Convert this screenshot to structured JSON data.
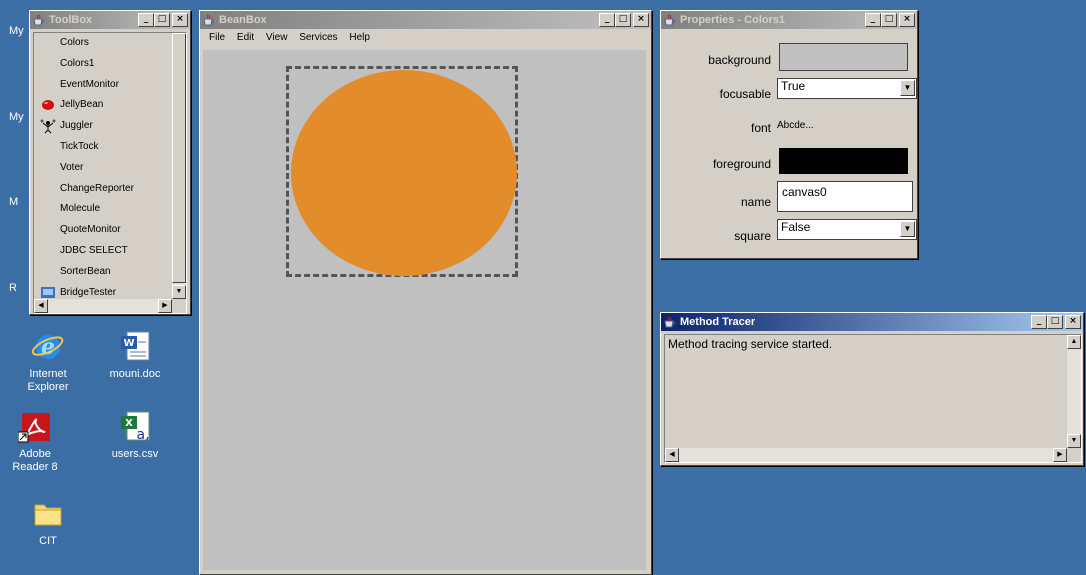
{
  "desktop": {
    "left_labels": [
      "My",
      "My",
      "M",
      "R"
    ],
    "icons": [
      {
        "label": "Internet Explorer",
        "icon": "internet-explorer-icon"
      },
      {
        "label": "mouni.doc",
        "icon": "word-document-icon"
      },
      {
        "label": "Adobe Reader 8",
        "icon": "adobe-reader-icon"
      },
      {
        "label": "users.csv",
        "icon": "excel-csv-icon"
      },
      {
        "label": "CIT",
        "icon": "folder-icon"
      }
    ]
  },
  "toolbox": {
    "title": "ToolBox",
    "items": [
      "Colors",
      "Colors1",
      "EventMonitor",
      "JellyBean",
      "Juggler",
      "TickTock",
      "Voter",
      "ChangeReporter",
      "Molecule",
      "QuoteMonitor",
      "JDBC SELECT",
      "SorterBean",
      "BridgeTester"
    ]
  },
  "beanbox": {
    "title": "BeanBox",
    "menu": [
      "File",
      "Edit",
      "View",
      "Services",
      "Help"
    ],
    "circle_color": "#e38c2b"
  },
  "properties": {
    "title": "Properties - Colors1",
    "labels": {
      "background": "background",
      "focusable": "focusable",
      "font": "font",
      "foreground": "foreground",
      "name": "name",
      "square": "square"
    },
    "focusable_value": "True",
    "font_value": "Abcde...",
    "name_value": "canvas0",
    "square_value": "False",
    "background_color": "#c0c0c0",
    "foreground_color": "#000000"
  },
  "tracer": {
    "title": "Method Tracer",
    "text": "Method tracing service started."
  }
}
